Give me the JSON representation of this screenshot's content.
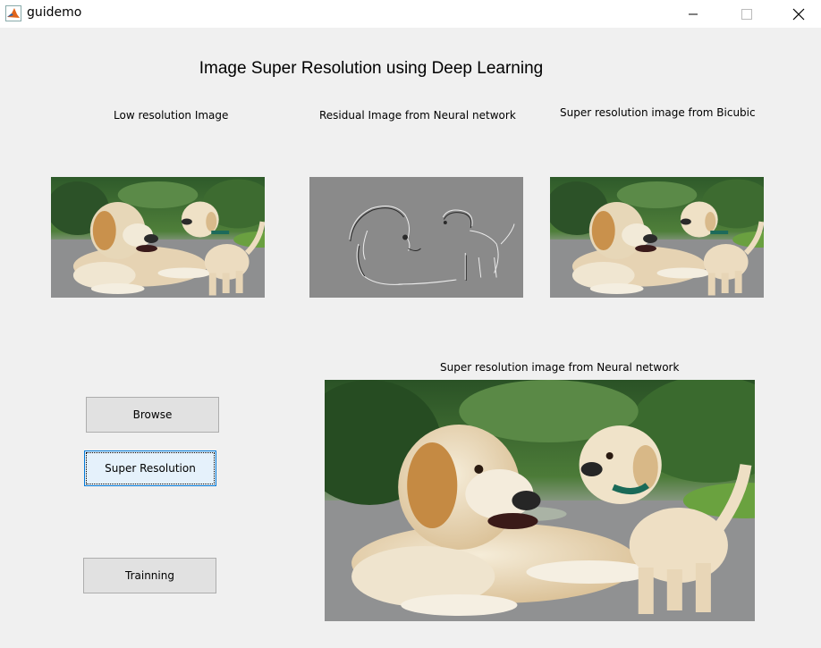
{
  "window": {
    "title": "guidemo"
  },
  "heading": "Image Super Resolution using Deep Learning",
  "panels": {
    "low_res_label": "Low resolution Image",
    "residual_label": "Residual Image from  Neural network",
    "bicubic_label": "Super resolution image from Bicubic",
    "neural_label": "Super resolution image from Neural network"
  },
  "buttons": {
    "browse": "Browse",
    "super_resolution": "Super Resolution",
    "training": "Trainning"
  },
  "colors": {
    "accent": "#0078d7",
    "window_bg": "#f0f0f0",
    "button_bg": "#e1e1e1"
  }
}
